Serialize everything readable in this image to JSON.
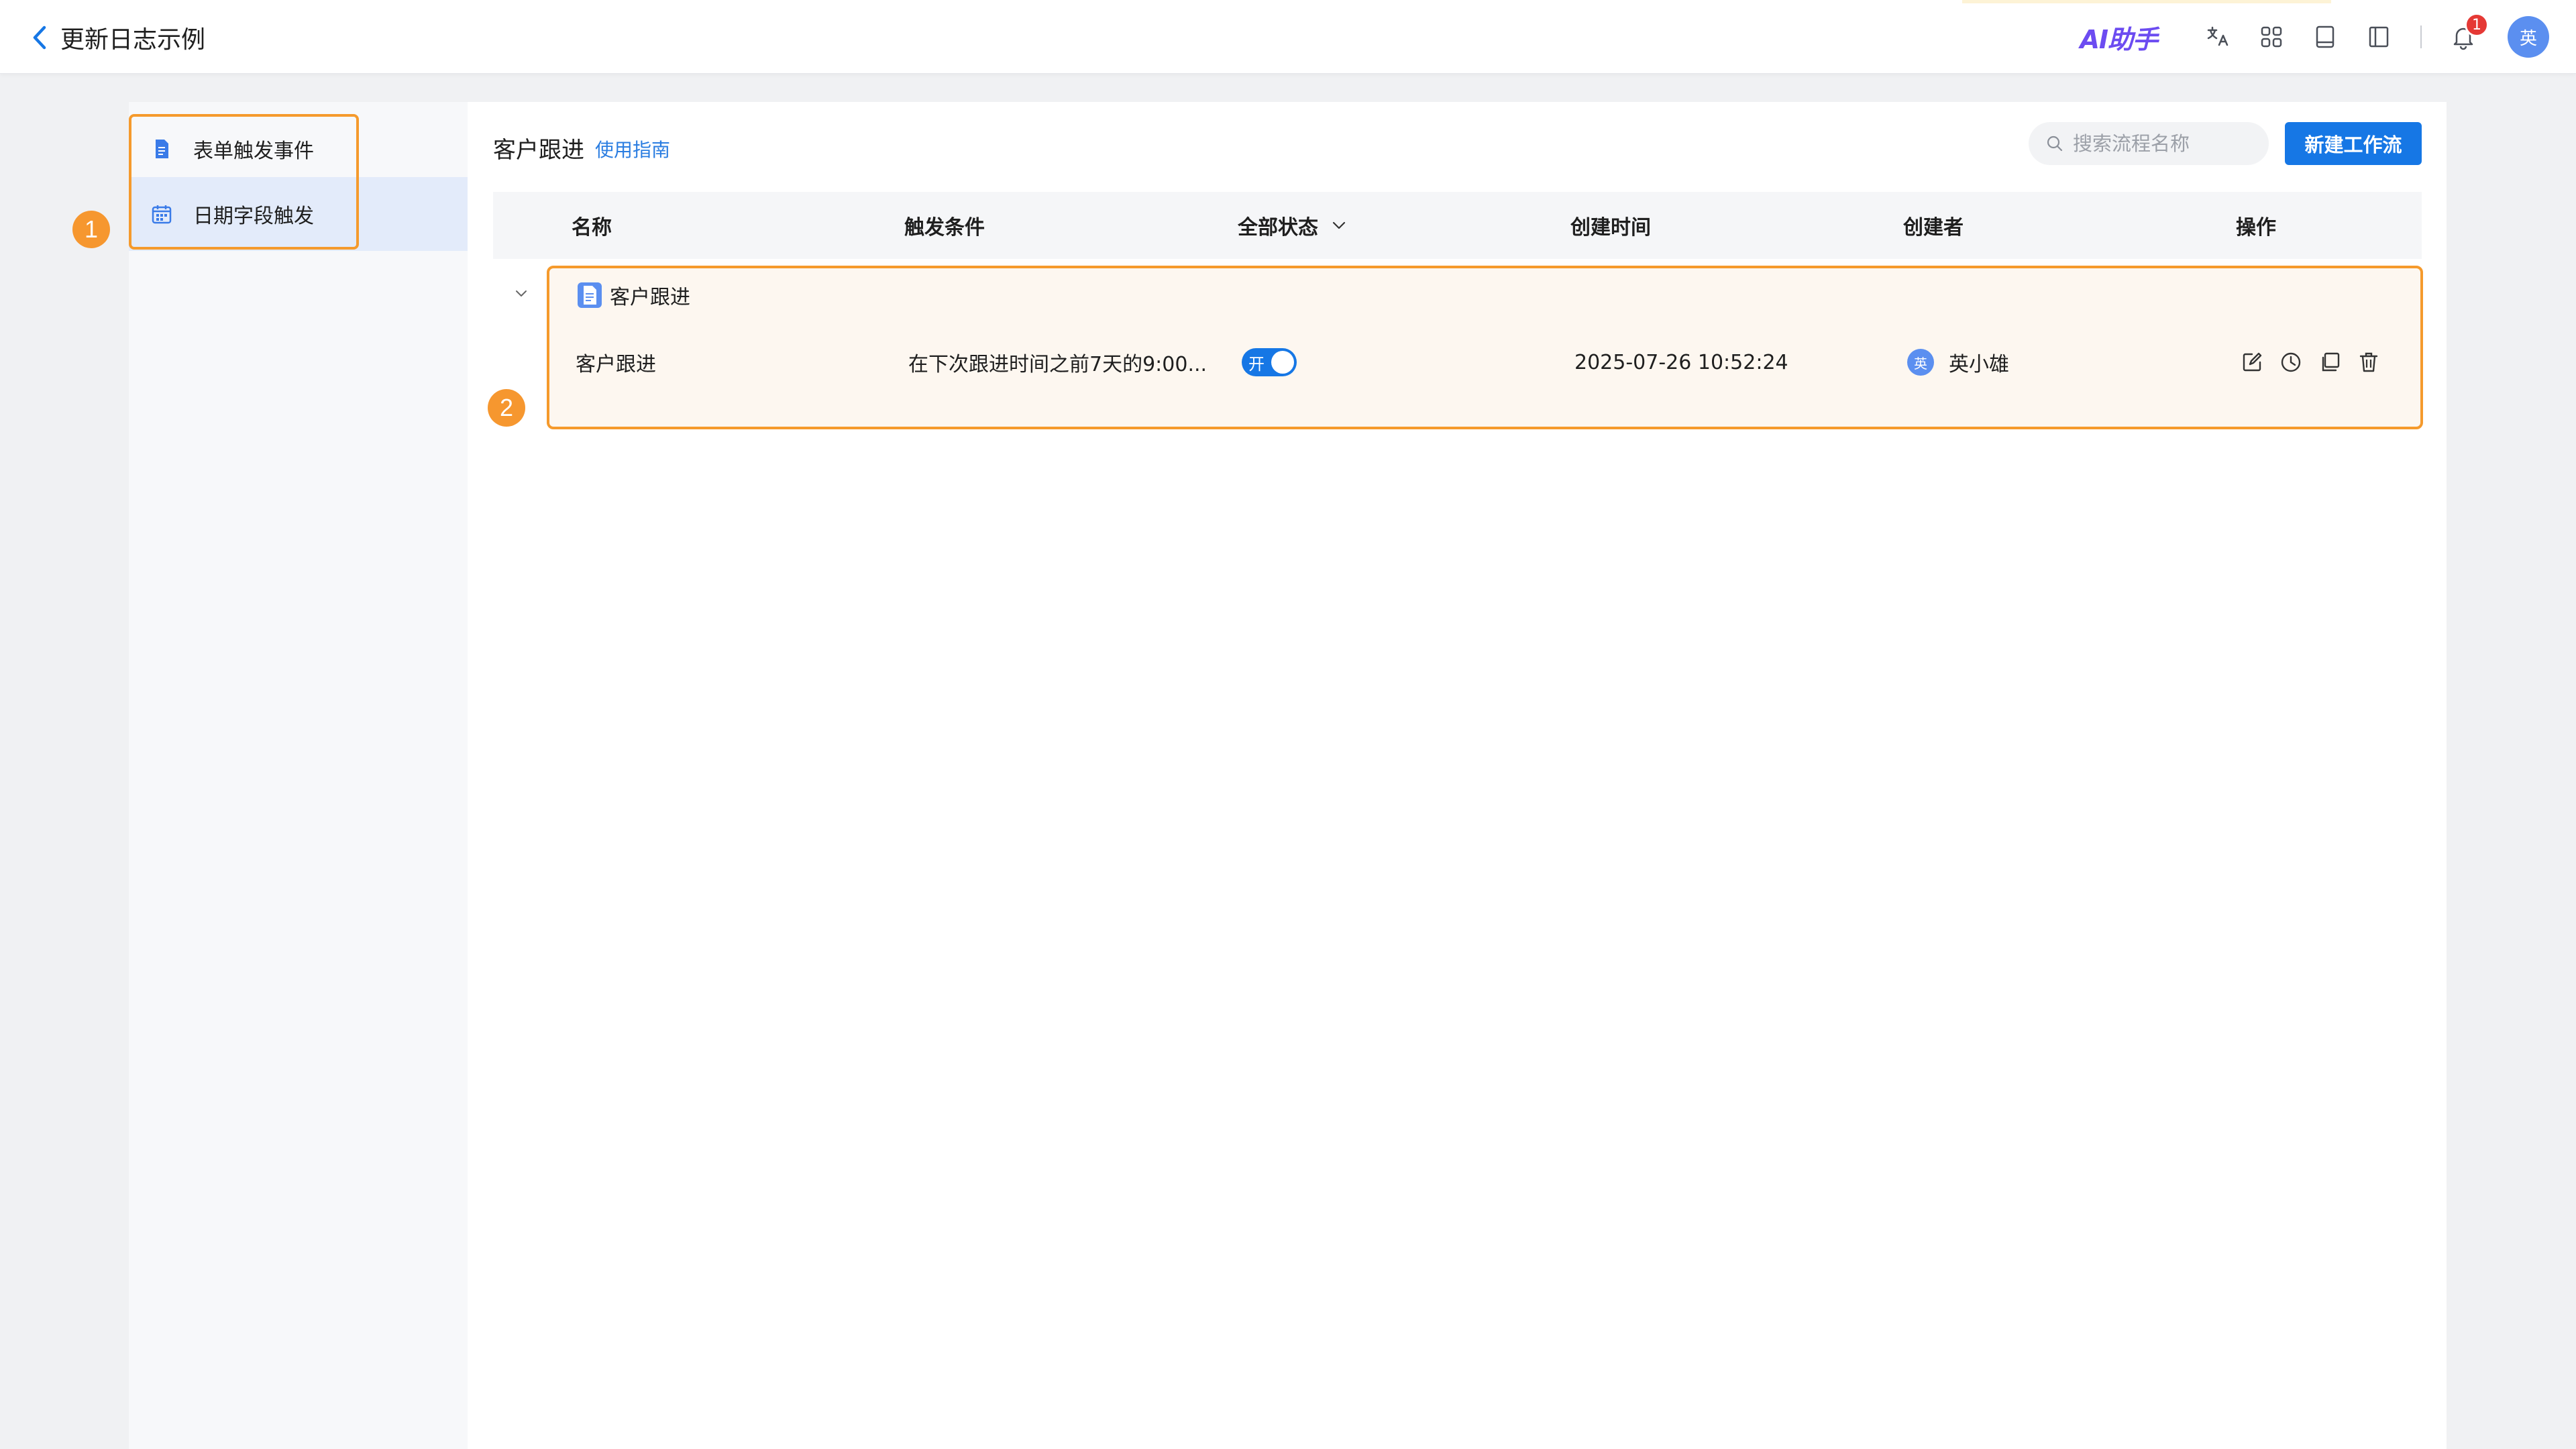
{
  "header": {
    "title": "更新日志示例",
    "ai_label": "AI助手",
    "notification_count": "1",
    "user_avatar": "英",
    "icons": [
      "back-arrow-icon",
      "translate-icon",
      "apps-grid-icon",
      "book-icon",
      "sidebar-panel-icon",
      "bell-icon"
    ]
  },
  "sidebar": {
    "items": [
      {
        "label": "表单触发事件",
        "icon": "document-icon"
      },
      {
        "label": "日期字段触发",
        "icon": "calendar-icon"
      }
    ]
  },
  "markers": [
    "1",
    "2"
  ],
  "main": {
    "title": "客户跟进",
    "guide_link": "使用指南",
    "search_placeholder": "搜索流程名称",
    "new_button": "新建工作流",
    "columns": [
      "名称",
      "触发条件",
      "全部状态",
      "创建时间",
      "创建者",
      "操作"
    ],
    "group": {
      "name": "客户跟进",
      "rows": [
        {
          "name": "客户跟进",
          "trigger": "在下次跟进时间之前7天的9:00...",
          "status_label": "开",
          "status_on": true,
          "created_at": "2025-07-26 10:52:24",
          "creator_avatar": "英",
          "creator": "英小雄",
          "actions": [
            "edit-icon",
            "history-icon",
            "copy-icon",
            "delete-icon"
          ]
        }
      ]
    }
  },
  "colors": {
    "accent": "#1677e5",
    "highlight": "#f59a2c",
    "sidebar_active": "#e3ebfa"
  }
}
